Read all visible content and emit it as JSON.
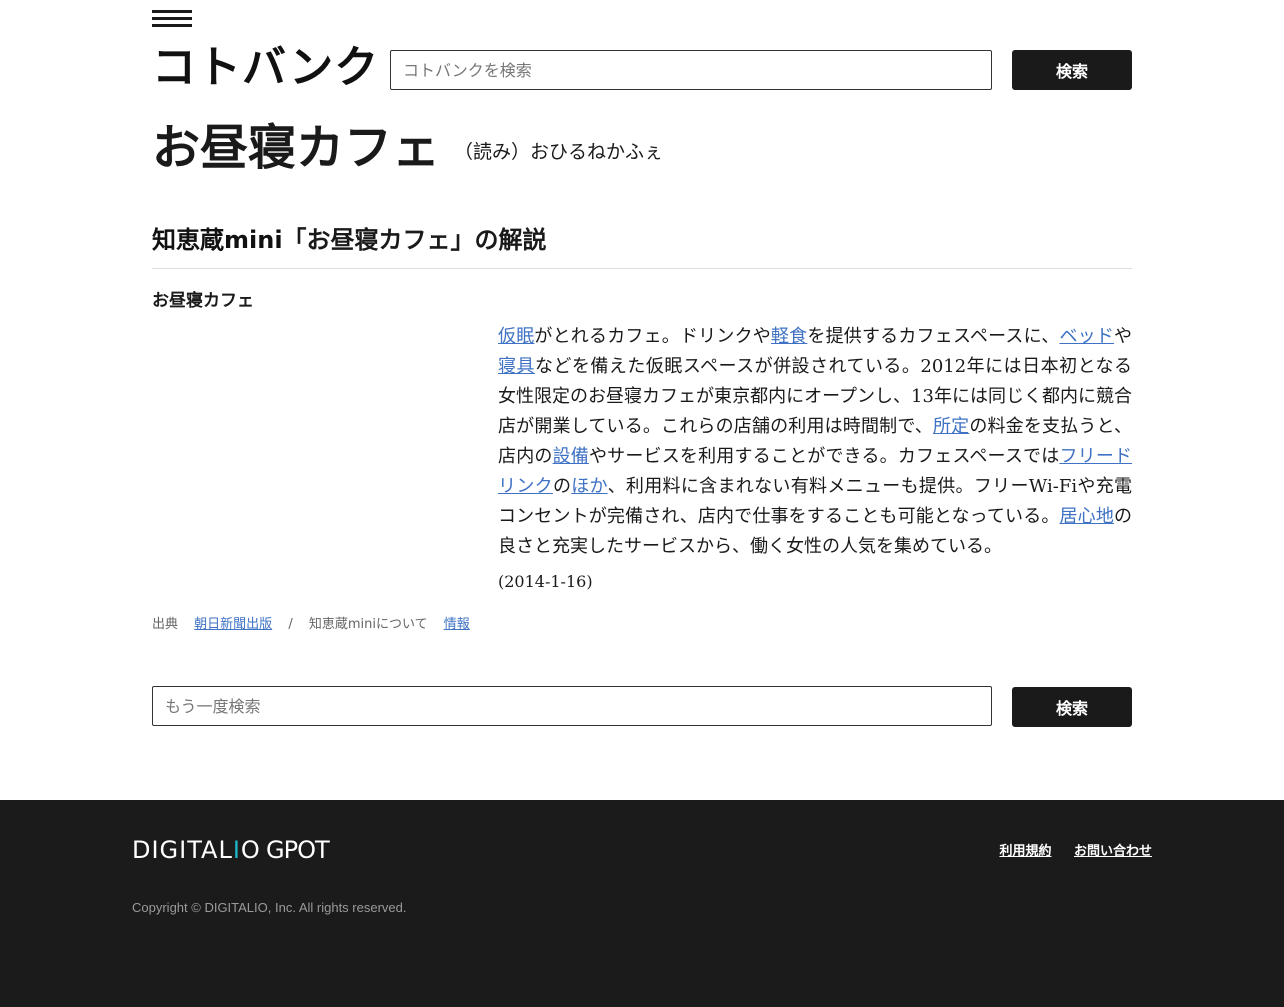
{
  "header": {
    "logo": "コトバンク",
    "search_placeholder": "コトバンクを検索",
    "search_button": "検索"
  },
  "entry": {
    "title": "お昼寝カフェ",
    "reading": "（読み）おひるねかふぇ"
  },
  "section": {
    "source_name": "知恵蔵mini",
    "heading_rest": "「お昼寝カフェ」の解説",
    "term": "お昼寝カフェ",
    "body": [
      {
        "type": "link",
        "text": "仮眠"
      },
      {
        "type": "text",
        "text": "がとれるカフェ。ドリンクや"
      },
      {
        "type": "link",
        "text": "軽食"
      },
      {
        "type": "text",
        "text": "を提供するカフェスペースに、"
      },
      {
        "type": "link",
        "text": "ベッド"
      },
      {
        "type": "text",
        "text": "や"
      },
      {
        "type": "link",
        "text": "寝具"
      },
      {
        "type": "text",
        "text": "などを備えた仮眠スペースが併設されている。2012年には日本初となる女性限定のお昼寝カフェが東京都内にオープンし、13年には同じく都内に競合店が開業している。これらの店舗の利用は時間制で、"
      },
      {
        "type": "link",
        "text": "所定"
      },
      {
        "type": "text",
        "text": "の料金を支払うと、店内の"
      },
      {
        "type": "link",
        "text": "設備"
      },
      {
        "type": "text",
        "text": "やサービスを利用することができる。カフェスペースでは"
      },
      {
        "type": "link",
        "text": "フリードリンク"
      },
      {
        "type": "text",
        "text": "の"
      },
      {
        "type": "link",
        "text": "ほか"
      },
      {
        "type": "text",
        "text": "、利用料に含まれない有料メニューも提供。フリーWi-Fiや充電コンセントが完備され、店内で仕事をすることも可能となっている。"
      },
      {
        "type": "link",
        "text": "居心地"
      },
      {
        "type": "text",
        "text": "の良さと充実したサービスから、働く女性の人気を集めている。"
      }
    ],
    "date": "(2014-1-16)",
    "source_label": "出典",
    "publisher": "朝日新聞出版",
    "separator": "/",
    "about": "知恵蔵miniについて",
    "info_link": "情報"
  },
  "bottom_search": {
    "placeholder": "もう一度検索",
    "button": "検索"
  },
  "footer": {
    "brand_1": "DIGITAL",
    "brand_dot": "I",
    "brand_1_end": "O",
    "brand_2": "GPOT",
    "links": [
      "利用規約",
      "お問い合わせ"
    ],
    "copyright": "Copyright © DIGITALIO, Inc. All rights reserved."
  }
}
